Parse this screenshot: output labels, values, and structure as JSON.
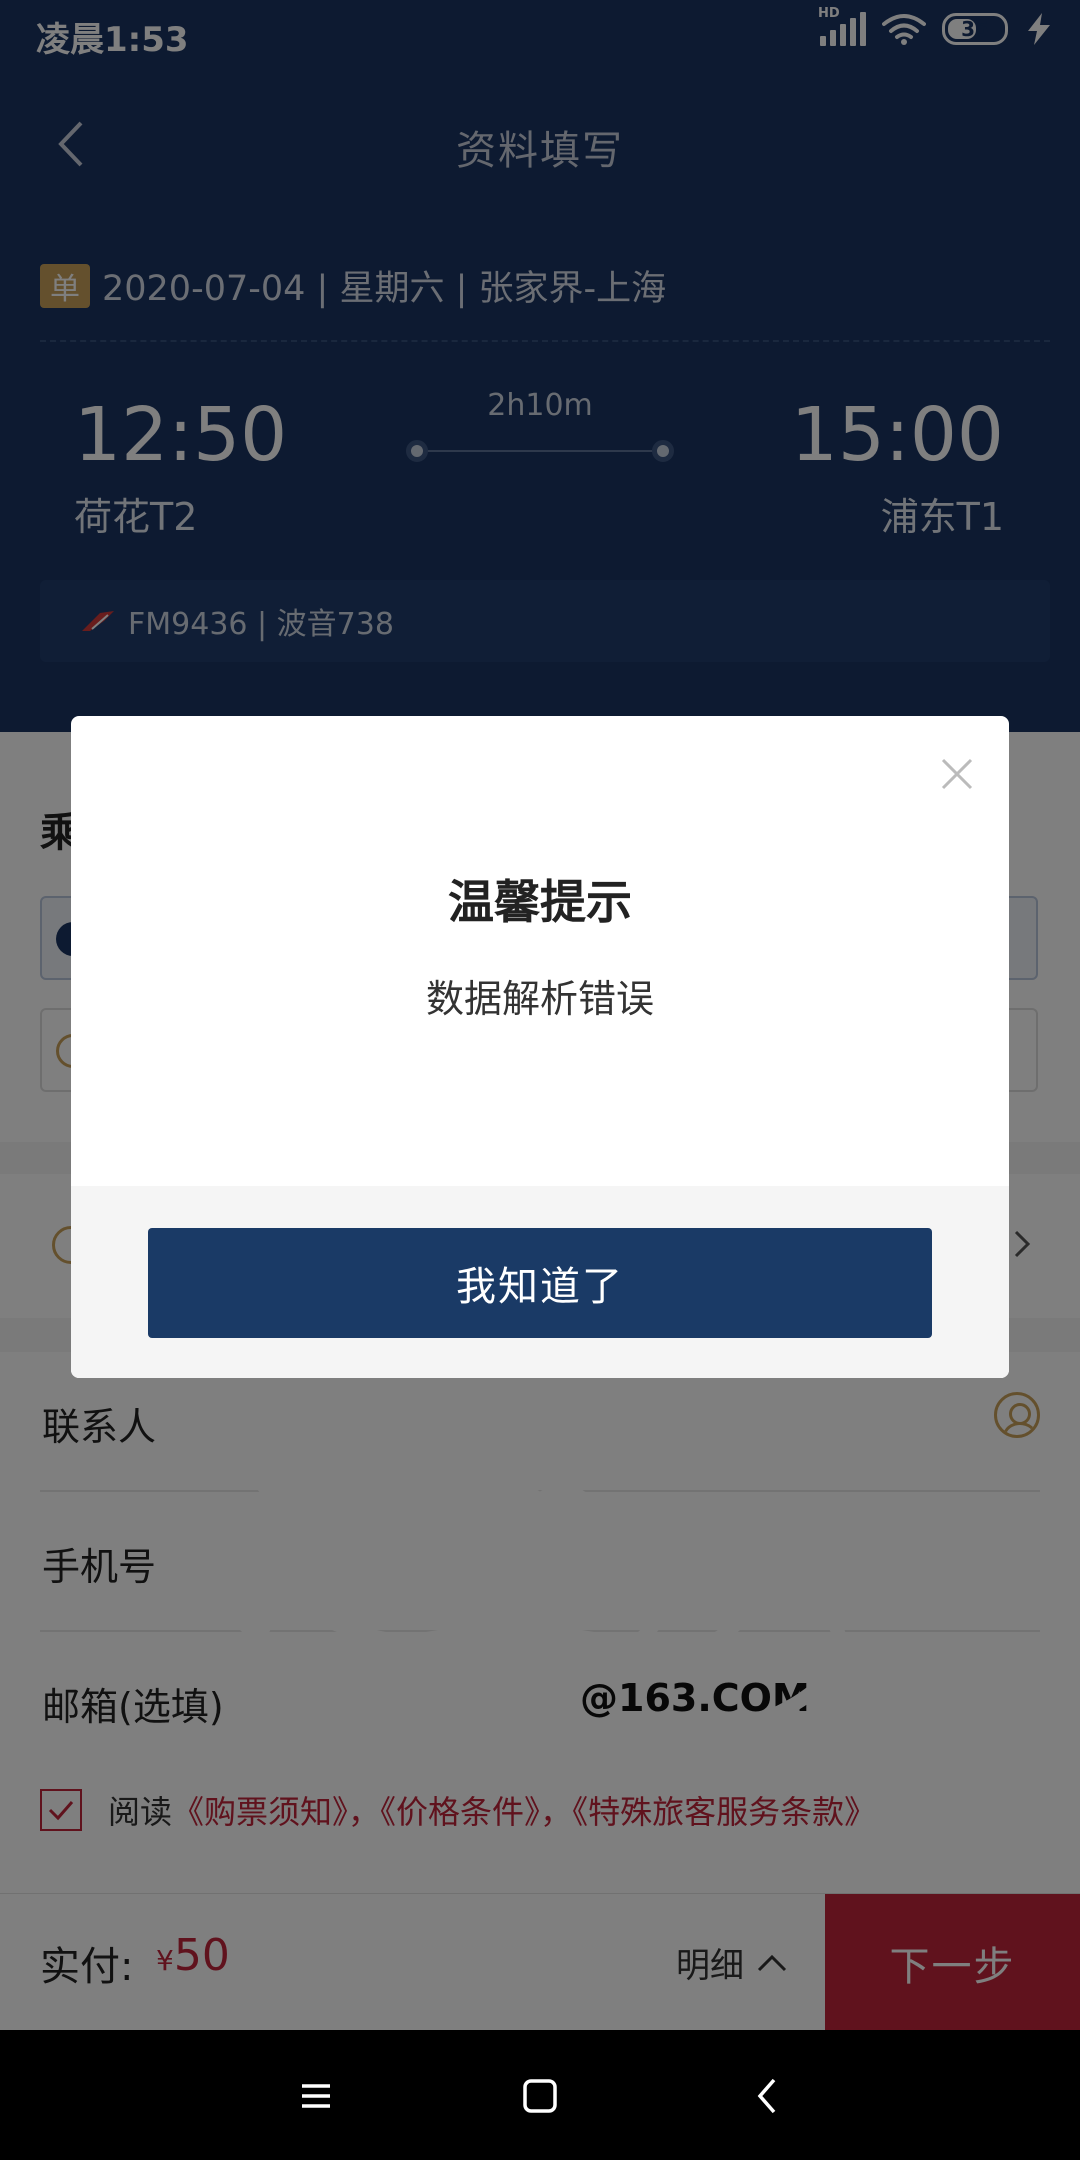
{
  "status_bar": {
    "time": "凌晨1:53",
    "network_label": "HD",
    "battery": "35"
  },
  "nav": {
    "title": "资料填写"
  },
  "trip": {
    "badge": "单",
    "info": "2020-07-04 | 星期六 | 张家界-上海",
    "dep_time": "12:50",
    "dep_airport": "荷花T2",
    "duration": "2h10m",
    "arr_time": "15:00",
    "arr_airport": "浦东T1",
    "flight": "FM9436 | 波音738"
  },
  "passenger": {
    "title_partial": "乘"
  },
  "form": {
    "contact_label": "联系人",
    "phone_label": "手机号",
    "email_label": "邮箱(选填)",
    "email_value_partial": "@163.COM"
  },
  "agree": {
    "prefix": "阅读",
    "link1": "《购票须知》",
    "sep1": "，",
    "link2": "《价格条件》",
    "sep2": "，",
    "link3": "《特殊旅客服务条款》"
  },
  "bottom": {
    "pay_label": "实付:",
    "currency": "¥",
    "amount": "50",
    "detail": "明细",
    "next": "下一步"
  },
  "dialog": {
    "title": "温馨提示",
    "message": "数据解析错误",
    "button": "我知道了"
  },
  "colors": {
    "header_bg": "#1a3563",
    "accent_red": "#c0243a",
    "gold": "#c9a15a",
    "dialog_button": "#1a3a66"
  },
  "icons": [
    "back-arrow-icon",
    "close-icon",
    "plane-icon",
    "contact-icon",
    "chevron-up-icon",
    "chevron-right-icon",
    "menu-icon",
    "home-icon",
    "nav-back-icon"
  ]
}
